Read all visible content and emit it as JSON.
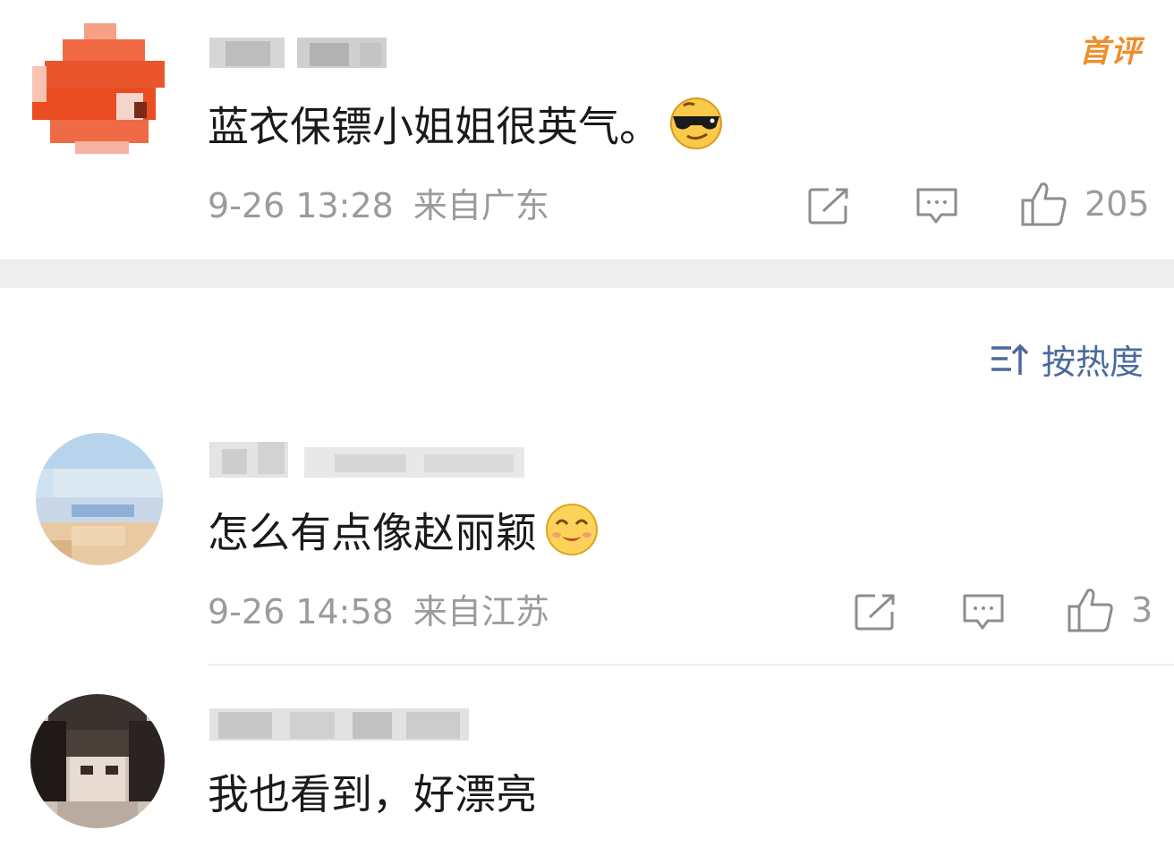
{
  "sort": {
    "label": "按热度"
  },
  "comments": [
    {
      "text": "蓝衣保镖小姐姐很英气。",
      "time": "9-26 13:28",
      "location": "来自广东",
      "likes": "205",
      "badge": "首评",
      "emoji": "sunglasses-emoji"
    },
    {
      "text": "怎么有点像赵丽颖",
      "time": "9-26 14:58",
      "location": "来自江苏",
      "likes": "3",
      "emoji": "smile-emoji"
    },
    {
      "text": "我也看到，好漂亮"
    }
  ],
  "colors": {
    "badge": "#f08d2c",
    "sort": "#4a6a9c",
    "meta": "#9b9b9b",
    "divider": "#eeeeef"
  }
}
